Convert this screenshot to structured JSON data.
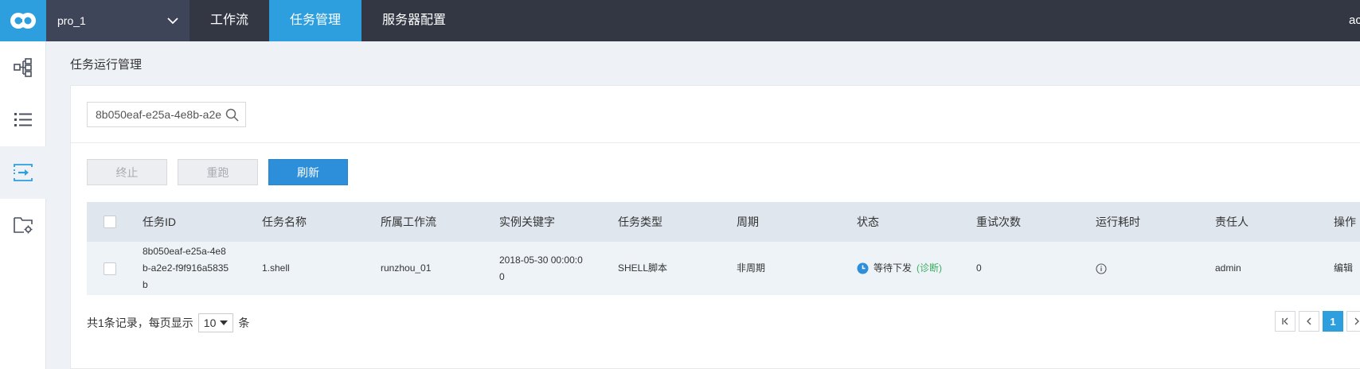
{
  "header": {
    "project": "pro_1",
    "nav": [
      "工作流",
      "任务管理",
      "服务器配置"
    ],
    "user": "ac"
  },
  "page": {
    "title": "任务运行管理"
  },
  "search": {
    "value": "8b050eaf-e25a-4e8b-a2e"
  },
  "buttons": {
    "stop": "终止",
    "rerun": "重跑",
    "refresh": "刷新"
  },
  "table": {
    "columns": [
      "任务ID",
      "任务名称",
      "所属工作流",
      "实例关键字",
      "任务类型",
      "周期",
      "状态",
      "重试次数",
      "运行耗时",
      "责任人",
      "操作"
    ],
    "rows": [
      {
        "id": [
          "8b050eaf-e25a-4e8",
          "b-a2e2-f9f916a5835",
          "b"
        ],
        "name": "1.shell",
        "workflow": "runzhou_01",
        "key": [
          "2018-05-30 00:00:0",
          "0"
        ],
        "type": "SHELL脚本",
        "cycle": "非周期",
        "status": "等待下发",
        "diagnose": "(诊断)",
        "retries": "0",
        "owner": "admin",
        "action": "编辑"
      }
    ]
  },
  "footer": {
    "prefix": "共1条记录，每页显示",
    "page_size": "10",
    "suffix": "条",
    "current_page": "1"
  },
  "colors": {
    "accent": "#2d9ede",
    "topbar": "#333744",
    "link_green": "#3cae5f"
  }
}
